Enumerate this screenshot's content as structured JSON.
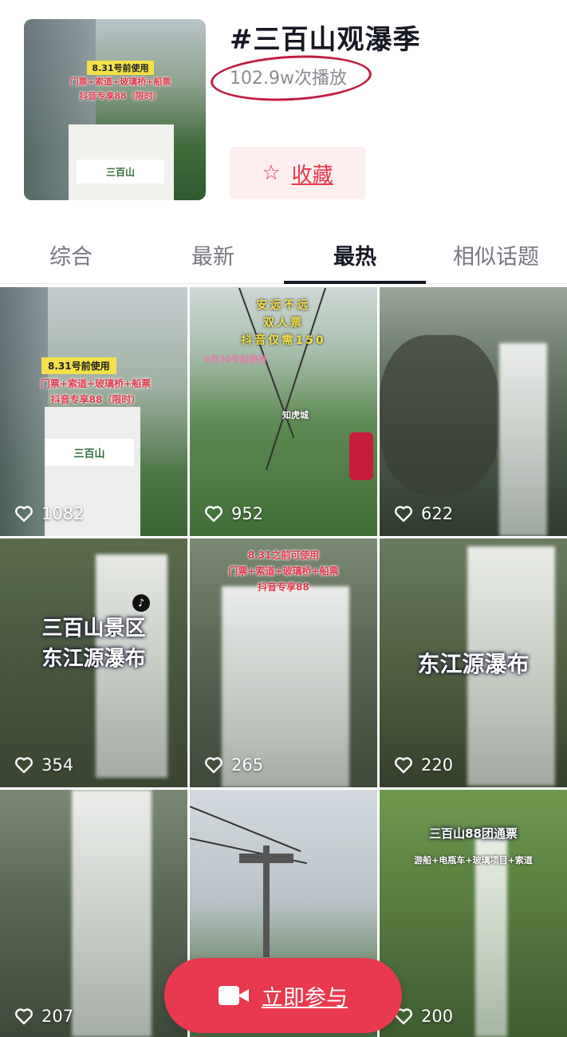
{
  "topic": {
    "title": "#三百山观瀑季",
    "plays": "102.9w次播放",
    "favorite_label": "收藏",
    "cover": {
      "caption_yellow": "8.31号前使用",
      "caption_line1": "门票+索道+玻璃桥+船票",
      "caption_line2": "抖音专享88（限时）",
      "sign": "三百山"
    }
  },
  "tabs": [
    {
      "label": "综合",
      "active": false
    },
    {
      "label": "最新",
      "active": false
    },
    {
      "label": "最热",
      "active": true
    },
    {
      "label": "相似话题",
      "active": false
    }
  ],
  "videos": [
    {
      "likes": "1082",
      "overlay": {
        "yellow": "8.31号前使用",
        "red1": "门票+索道+玻璃桥+船票",
        "red2": "抖音专享88（限时）",
        "sign": "三百山"
      }
    },
    {
      "likes": "952",
      "overlay": {
        "line1": "安远不远",
        "line2": "双人票",
        "line3": "抖音仅需150",
        "pink": "6月30号前使用",
        "place": "知虎城"
      }
    },
    {
      "likes": "622"
    },
    {
      "likes": "354",
      "overlay": {
        "line1": "三百山景区",
        "line2": "东江源瀑布"
      }
    },
    {
      "likes": "265",
      "overlay": {
        "red1": "8.31之前可使用",
        "red2": "门票+索道+玻璃桥+船票",
        "red3": "抖音专享88"
      }
    },
    {
      "likes": "220",
      "overlay": {
        "line1": "东江源瀑布"
      }
    },
    {
      "likes": "207"
    },
    {
      "likes": ""
    },
    {
      "likes": "200",
      "overlay": {
        "line1": "三百山88团通票",
        "line2": "游船+电瓶车+玻璃项目+索道"
      }
    }
  ],
  "join_button": {
    "label": "立即参与",
    "icon": "video-camera-icon"
  },
  "colors": {
    "accent": "#e8394e",
    "circle": "#c01d3f",
    "text": "#161823",
    "muted": "#8a8b91"
  }
}
